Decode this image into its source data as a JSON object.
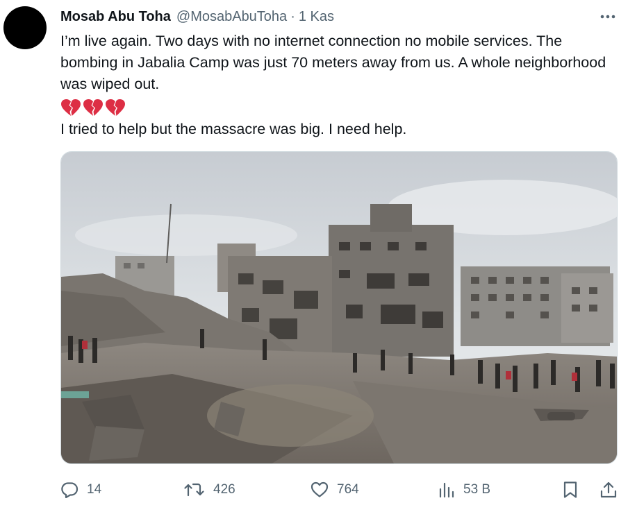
{
  "tweet": {
    "author": {
      "display_name": "Mosab Abu Toha",
      "handle": "@MosabAbuToha",
      "separator": "·",
      "timestamp": "1 Kas"
    },
    "text": {
      "line1": "I’m live again. Two days with no internet connection no mobile services. The bombing in Jabalia Camp was just 70 meters away from us. A whole neighborhood was wiped out.",
      "emoji": [
        "broken-heart",
        "broken-heart",
        "broken-heart"
      ],
      "line2": "I tried to help but the massacre was big. I need help."
    },
    "media": {
      "type": "photo"
    },
    "actions": {
      "replies": "14",
      "reposts": "426",
      "likes": "764",
      "views": "53 B"
    },
    "icons": {
      "more": "more-horizontal-icon",
      "reply": "reply-icon",
      "repost": "repost-icon",
      "like": "heart-icon",
      "views": "views-icon",
      "bookmark": "bookmark-icon",
      "share": "share-icon"
    },
    "colors": {
      "text": "#0f1419",
      "secondary": "#536471",
      "border": "#cfd9de",
      "emoji": "#dd2e44"
    }
  }
}
